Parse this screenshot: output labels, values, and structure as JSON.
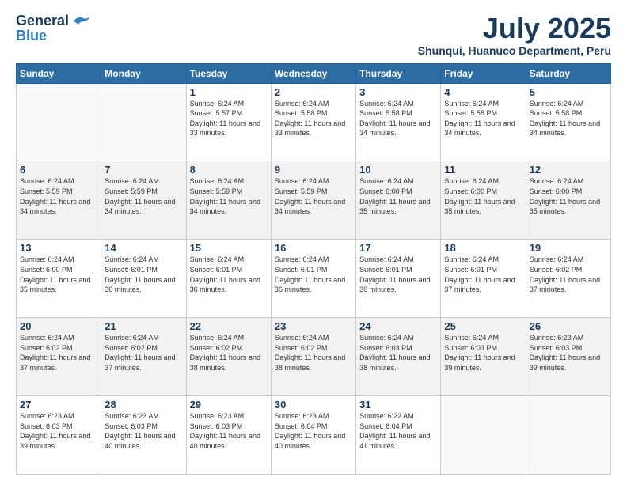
{
  "header": {
    "logo_line1": "General",
    "logo_line2": "Blue",
    "month": "July 2025",
    "location": "Shunqui, Huanuco Department, Peru"
  },
  "days_of_week": [
    "Sunday",
    "Monday",
    "Tuesday",
    "Wednesday",
    "Thursday",
    "Friday",
    "Saturday"
  ],
  "weeks": [
    [
      {
        "day": "",
        "sunrise": "",
        "sunset": "",
        "daylight": ""
      },
      {
        "day": "",
        "sunrise": "",
        "sunset": "",
        "daylight": ""
      },
      {
        "day": "1",
        "sunrise": "Sunrise: 6:24 AM",
        "sunset": "Sunset: 5:57 PM",
        "daylight": "Daylight: 11 hours and 33 minutes."
      },
      {
        "day": "2",
        "sunrise": "Sunrise: 6:24 AM",
        "sunset": "Sunset: 5:58 PM",
        "daylight": "Daylight: 11 hours and 33 minutes."
      },
      {
        "day": "3",
        "sunrise": "Sunrise: 6:24 AM",
        "sunset": "Sunset: 5:58 PM",
        "daylight": "Daylight: 11 hours and 34 minutes."
      },
      {
        "day": "4",
        "sunrise": "Sunrise: 6:24 AM",
        "sunset": "Sunset: 5:58 PM",
        "daylight": "Daylight: 11 hours and 34 minutes."
      },
      {
        "day": "5",
        "sunrise": "Sunrise: 6:24 AM",
        "sunset": "Sunset: 5:58 PM",
        "daylight": "Daylight: 11 hours and 34 minutes."
      }
    ],
    [
      {
        "day": "6",
        "sunrise": "Sunrise: 6:24 AM",
        "sunset": "Sunset: 5:59 PM",
        "daylight": "Daylight: 11 hours and 34 minutes."
      },
      {
        "day": "7",
        "sunrise": "Sunrise: 6:24 AM",
        "sunset": "Sunset: 5:59 PM",
        "daylight": "Daylight: 11 hours and 34 minutes."
      },
      {
        "day": "8",
        "sunrise": "Sunrise: 6:24 AM",
        "sunset": "Sunset: 5:59 PM",
        "daylight": "Daylight: 11 hours and 34 minutes."
      },
      {
        "day": "9",
        "sunrise": "Sunrise: 6:24 AM",
        "sunset": "Sunset: 5:59 PM",
        "daylight": "Daylight: 11 hours and 34 minutes."
      },
      {
        "day": "10",
        "sunrise": "Sunrise: 6:24 AM",
        "sunset": "Sunset: 6:00 PM",
        "daylight": "Daylight: 11 hours and 35 minutes."
      },
      {
        "day": "11",
        "sunrise": "Sunrise: 6:24 AM",
        "sunset": "Sunset: 6:00 PM",
        "daylight": "Daylight: 11 hours and 35 minutes."
      },
      {
        "day": "12",
        "sunrise": "Sunrise: 6:24 AM",
        "sunset": "Sunset: 6:00 PM",
        "daylight": "Daylight: 11 hours and 35 minutes."
      }
    ],
    [
      {
        "day": "13",
        "sunrise": "Sunrise: 6:24 AM",
        "sunset": "Sunset: 6:00 PM",
        "daylight": "Daylight: 11 hours and 35 minutes."
      },
      {
        "day": "14",
        "sunrise": "Sunrise: 6:24 AM",
        "sunset": "Sunset: 6:01 PM",
        "daylight": "Daylight: 11 hours and 36 minutes."
      },
      {
        "day": "15",
        "sunrise": "Sunrise: 6:24 AM",
        "sunset": "Sunset: 6:01 PM",
        "daylight": "Daylight: 11 hours and 36 minutes."
      },
      {
        "day": "16",
        "sunrise": "Sunrise: 6:24 AM",
        "sunset": "Sunset: 6:01 PM",
        "daylight": "Daylight: 11 hours and 36 minutes."
      },
      {
        "day": "17",
        "sunrise": "Sunrise: 6:24 AM",
        "sunset": "Sunset: 6:01 PM",
        "daylight": "Daylight: 11 hours and 36 minutes."
      },
      {
        "day": "18",
        "sunrise": "Sunrise: 6:24 AM",
        "sunset": "Sunset: 6:01 PM",
        "daylight": "Daylight: 11 hours and 37 minutes."
      },
      {
        "day": "19",
        "sunrise": "Sunrise: 6:24 AM",
        "sunset": "Sunset: 6:02 PM",
        "daylight": "Daylight: 11 hours and 37 minutes."
      }
    ],
    [
      {
        "day": "20",
        "sunrise": "Sunrise: 6:24 AM",
        "sunset": "Sunset: 6:02 PM",
        "daylight": "Daylight: 11 hours and 37 minutes."
      },
      {
        "day": "21",
        "sunrise": "Sunrise: 6:24 AM",
        "sunset": "Sunset: 6:02 PM",
        "daylight": "Daylight: 11 hours and 37 minutes."
      },
      {
        "day": "22",
        "sunrise": "Sunrise: 6:24 AM",
        "sunset": "Sunset: 6:02 PM",
        "daylight": "Daylight: 11 hours and 38 minutes."
      },
      {
        "day": "23",
        "sunrise": "Sunrise: 6:24 AM",
        "sunset": "Sunset: 6:02 PM",
        "daylight": "Daylight: 11 hours and 38 minutes."
      },
      {
        "day": "24",
        "sunrise": "Sunrise: 6:24 AM",
        "sunset": "Sunset: 6:03 PM",
        "daylight": "Daylight: 11 hours and 38 minutes."
      },
      {
        "day": "25",
        "sunrise": "Sunrise: 6:24 AM",
        "sunset": "Sunset: 6:03 PM",
        "daylight": "Daylight: 11 hours and 39 minutes."
      },
      {
        "day": "26",
        "sunrise": "Sunrise: 6:23 AM",
        "sunset": "Sunset: 6:03 PM",
        "daylight": "Daylight: 11 hours and 39 minutes."
      }
    ],
    [
      {
        "day": "27",
        "sunrise": "Sunrise: 6:23 AM",
        "sunset": "Sunset: 6:03 PM",
        "daylight": "Daylight: 11 hours and 39 minutes."
      },
      {
        "day": "28",
        "sunrise": "Sunrise: 6:23 AM",
        "sunset": "Sunset: 6:03 PM",
        "daylight": "Daylight: 11 hours and 40 minutes."
      },
      {
        "day": "29",
        "sunrise": "Sunrise: 6:23 AM",
        "sunset": "Sunset: 6:03 PM",
        "daylight": "Daylight: 11 hours and 40 minutes."
      },
      {
        "day": "30",
        "sunrise": "Sunrise: 6:23 AM",
        "sunset": "Sunset: 6:04 PM",
        "daylight": "Daylight: 11 hours and 40 minutes."
      },
      {
        "day": "31",
        "sunrise": "Sunrise: 6:22 AM",
        "sunset": "Sunset: 6:04 PM",
        "daylight": "Daylight: 11 hours and 41 minutes."
      },
      {
        "day": "",
        "sunrise": "",
        "sunset": "",
        "daylight": ""
      },
      {
        "day": "",
        "sunrise": "",
        "sunset": "",
        "daylight": ""
      }
    ]
  ]
}
